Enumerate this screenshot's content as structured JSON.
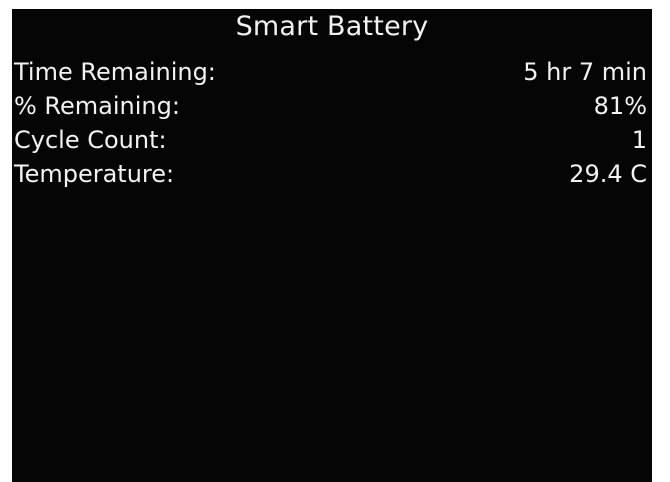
{
  "title": "Smart Battery",
  "rows": [
    {
      "label": "Time Remaining:",
      "value": "5 hr 7 min"
    },
    {
      "label": "% Remaining:",
      "value": "81%"
    },
    {
      "label": "Cycle Count:",
      "value": "1"
    },
    {
      "label": "Temperature:",
      "value": "29.4 C"
    }
  ],
  "colors": {
    "background": "#050505",
    "text": "#f2f2f2",
    "page": "#ffffff"
  }
}
